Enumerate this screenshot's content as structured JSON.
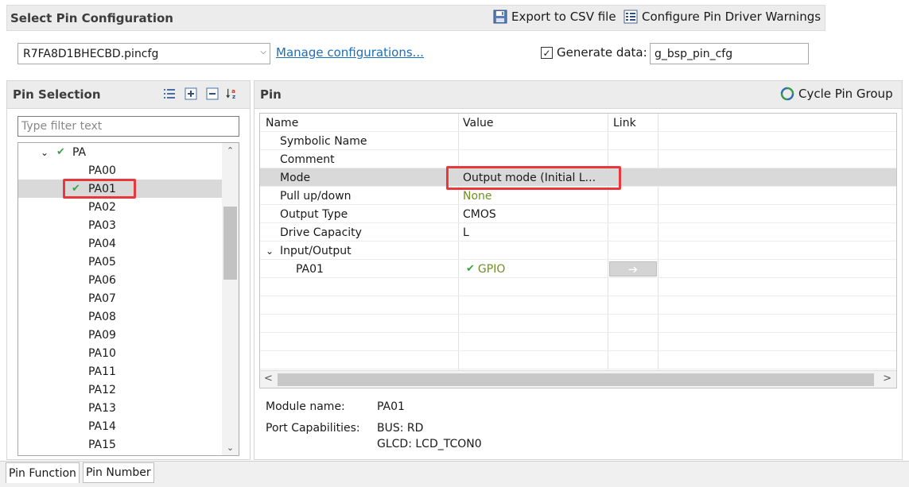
{
  "header": {
    "title": "Select Pin Configuration",
    "export_label": "Export to CSV file",
    "warnings_label": "Configure Pin Driver Warnings"
  },
  "config": {
    "file": "R7FA8D1BHECBD.pincfg",
    "manage_label": "Manage configurations...",
    "generate_label": "Generate data:",
    "generate_checked": true,
    "generate_value": "g_bsp_pin_cfg"
  },
  "pin_selection": {
    "title": "Pin Selection",
    "filter_placeholder": "Type filter text",
    "group": "PA",
    "pins": [
      "PA00",
      "PA01",
      "PA02",
      "PA03",
      "PA04",
      "PA05",
      "PA06",
      "PA07",
      "PA08",
      "PA09",
      "PA10",
      "PA11",
      "PA12",
      "PA13",
      "PA14",
      "PA15"
    ],
    "selected": "PA01"
  },
  "pin_panel": {
    "title": "Pin",
    "cycle_label": "Cycle Pin Group",
    "columns": [
      "Name",
      "Value",
      "Link"
    ],
    "rows": [
      {
        "name": "Symbolic Name",
        "value": ""
      },
      {
        "name": "Comment",
        "value": ""
      },
      {
        "name": "Mode",
        "value": "Output mode (Initial L..."
      },
      {
        "name": "Pull up/down",
        "value": "None"
      },
      {
        "name": "Output Type",
        "value": "CMOS"
      },
      {
        "name": "Drive Capacity",
        "value": "L"
      },
      {
        "name": "Input/Output",
        "value": ""
      },
      {
        "name": "PA01",
        "value": "GPIO"
      }
    ]
  },
  "info": {
    "module_label": "Module name:",
    "module_value": "PA01",
    "port_label": "Port Capabilities:",
    "cap1": "BUS: RD",
    "cap2": "GLCD: LCD_TCON0"
  },
  "tabs": [
    "Pin Function",
    "Pin Number"
  ],
  "colors": {
    "highlight_box": "#e8383d",
    "link": "#1d6fb8",
    "check": "#3aa34a"
  }
}
